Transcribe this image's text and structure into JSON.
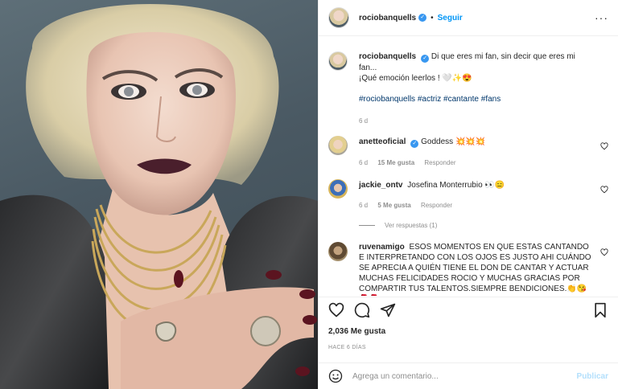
{
  "post": {
    "author": "rociobanquells",
    "follow_label": "Seguir",
    "dot": "•",
    "more": "···",
    "photo_alt": "rociobanquells post photo"
  },
  "caption": {
    "username": "rociobanquells",
    "text_line1": "Di que eres mi fan, sin decir que eres mi fan...",
    "text_line2": "¡Qué emoción leerlos ! 🤍✨😍",
    "hashtags": "#rociobanquells #actriz #cantante #fans",
    "time": "6 d"
  },
  "comments": [
    {
      "username": "anetteoficial",
      "verified": true,
      "text": "Goddess 💥💥💥",
      "time": "6 d",
      "likes": "15 Me gusta",
      "reply": "Responder"
    },
    {
      "username": "jackie_ontv",
      "verified": false,
      "text": "Josefina Monterrubio 👀😑",
      "time": "6 d",
      "likes": "5 Me gusta",
      "reply": "Responder"
    },
    {
      "username": "ruvenamigo",
      "verified": false,
      "text": "ESOS MOMENTOS EN QUE ESTAS CANTANDO E INTERPRETANDO CON LOS OJOS ES JUSTO AHI CUÁNDO SE APRECIA A QUIÉN TIENE EL DON DE CANTAR Y ACTUAR MUCHAS FELICIDADES ROCIO Y MUCHAS GRACIAS POR COMPARTIR TUS TALENTOS.SIEMPRE BENDICIONES.👏😘🌹🌹"
    }
  ],
  "view_replies": "Ver respuestas (1)",
  "likes_count": "2,036 Me gusta",
  "posted_ago": "HACE 6 DÍAS",
  "comment_box": {
    "placeholder": "Agrega un comentario...",
    "publish_label": "Publicar"
  },
  "icons": [
    "heart-icon",
    "comment-icon",
    "share-icon",
    "bookmark-icon",
    "emoji-icon",
    "verified-icon",
    "more-icon"
  ],
  "colors": {
    "link": "#0095f6",
    "hashtag": "#00376b",
    "verified": "#3897f0",
    "muted": "#8e8e8e",
    "publish_disabled": "#b2dffc"
  }
}
